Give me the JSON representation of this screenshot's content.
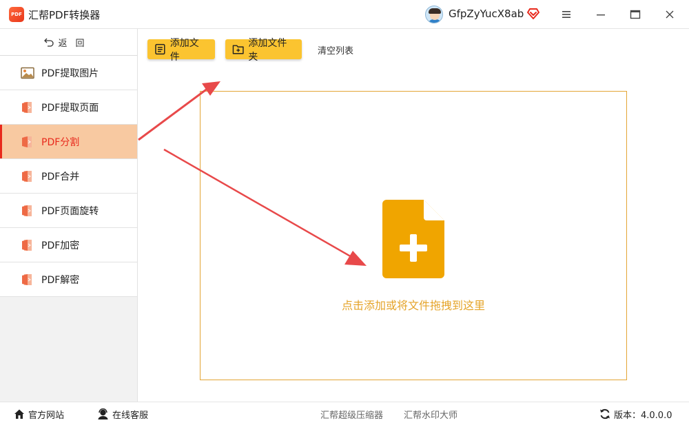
{
  "app": {
    "logo_text": "PDF",
    "title": "汇帮PDF转换器",
    "username": "GfpZyYucX8ab"
  },
  "sidebar": {
    "back_label": "返回",
    "items": [
      {
        "label": "PDF提取图片",
        "icon": "image-icon"
      },
      {
        "label": "PDF提取页面",
        "icon": "pdf-doc-icon"
      },
      {
        "label": "PDF分割",
        "icon": "pdf-doc-icon",
        "active": true
      },
      {
        "label": "PDF合并",
        "icon": "pdf-doc-icon"
      },
      {
        "label": "PDF页面旋转",
        "icon": "pdf-doc-icon"
      },
      {
        "label": "PDF加密",
        "icon": "pdf-doc-icon"
      },
      {
        "label": "PDF解密",
        "icon": "pdf-doc-icon"
      }
    ]
  },
  "toolbar": {
    "add_file": "添加文件",
    "add_folder": "添加文件夹",
    "clear_list": "清空列表"
  },
  "dropzone": {
    "text": "点击添加或将文件拖拽到这里"
  },
  "footer": {
    "official_site": "官方网站",
    "online_service": "在线客服",
    "compressor": "汇帮超级压缩器",
    "watermark": "汇帮水印大师",
    "version": "版本：4.0.0.0"
  },
  "colors": {
    "accent": "#fbc430",
    "active_bg": "#f8c9a1",
    "active_text": "#e8291c",
    "drop_icon": "#f0a500",
    "arrow": "#e8494a"
  }
}
